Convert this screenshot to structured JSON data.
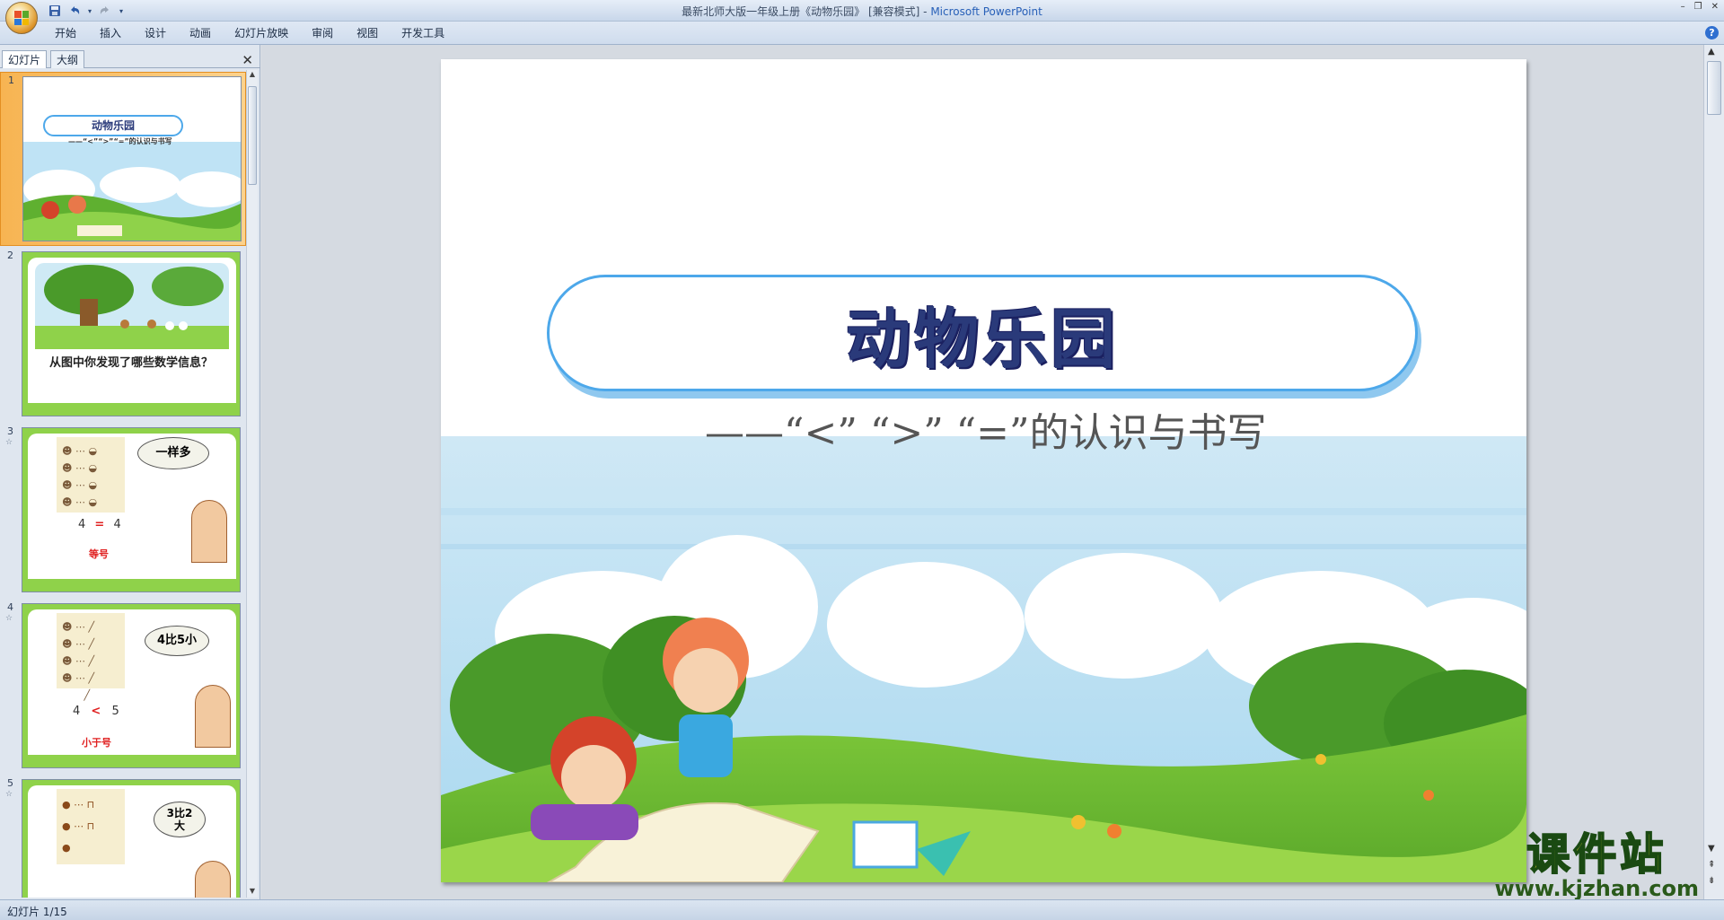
{
  "window": {
    "title": "最新北师大版一年级上册《动物乐园》 [兼容模式]",
    "app_name": "Microsoft PowerPoint",
    "controls": [
      "–",
      "❐",
      "✕"
    ]
  },
  "quick_access": {
    "save_icon": "save-icon",
    "undo_icon": "undo-icon",
    "redo_icon": "redo-icon",
    "customize_icon": "customize-qat-icon"
  },
  "ribbon": {
    "tabs": [
      "开始",
      "插入",
      "设计",
      "动画",
      "幻灯片放映",
      "审阅",
      "视图",
      "开发工具"
    ],
    "help": "?"
  },
  "left_pane": {
    "tab_slides": "幻灯片",
    "tab_outline": "大纲",
    "close": "✕",
    "slides": [
      {
        "number": "1",
        "title": "动物乐园",
        "subtitle": "——“<”“>”“=”的认识与书写"
      },
      {
        "number": "2",
        "caption": "从图中你发现了哪些数学信息？"
      },
      {
        "number": "3",
        "bubble": "一样多",
        "compare_left": "4",
        "compare_sign": "=",
        "compare_right": "4",
        "sign_name": "等号"
      },
      {
        "number": "4",
        "bubble": "4比5小",
        "compare_left": "4",
        "compare_sign": "<",
        "compare_right": "5",
        "sign_name": "小于号"
      },
      {
        "number": "5",
        "bubble": "3比2大"
      }
    ]
  },
  "slide": {
    "title": "动物乐园",
    "subtitle": "——“<” “>” “=”的认识与书写"
  },
  "status": {
    "slide_indicator": "幻灯片 1/15"
  },
  "watermark": {
    "main": "课件站",
    "url": "www.kjzhan.com"
  },
  "colors": {
    "title_border": "#4da8ea",
    "title_text": "#2a3a7a",
    "grass": "#7ec83a",
    "sky": "#bfe3f5",
    "selected_thumb": "#f7b452"
  }
}
